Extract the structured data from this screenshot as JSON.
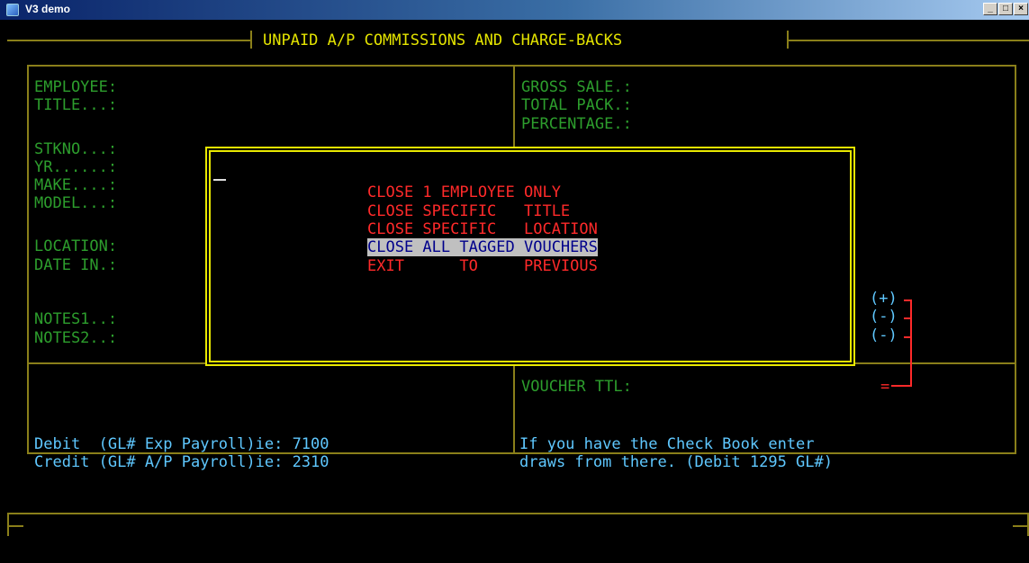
{
  "window": {
    "title": "V3 demo",
    "minimize_icon": "minimize-icon",
    "maximize_icon": "maximize-icon",
    "close_icon": "close-icon"
  },
  "header": {
    "title": "UNPAID A/P COMMISSIONS AND CHARGE-BACKS"
  },
  "fields_left": {
    "employee": "EMPLOYEE:",
    "title": "TITLE...:",
    "stkno": "STKNO...:",
    "yr": "YR......:",
    "make": "MAKE....:",
    "model": "MODEL...:",
    "location": "LOCATION:",
    "date_in": "DATE IN.:",
    "notes1": "NOTES1..:",
    "notes2": "NOTES2..:"
  },
  "fields_right": {
    "gross_sale": "GROSS SALE.:",
    "total_pack": "TOTAL PACK.:",
    "percentage": "PERCENTAGE.:",
    "voucher_ttl": "VOUCHER TTL:"
  },
  "calc_symbols": {
    "plus": "(+)",
    "minus1": "(-)",
    "minus2": "(-)",
    "equals": "="
  },
  "menu": {
    "items": [
      {
        "label": "CLOSE 1 EMPLOYEE ONLY"
      },
      {
        "label": "CLOSE SPECIFIC   TITLE"
      },
      {
        "label": "CLOSE SPECIFIC   LOCATION"
      },
      {
        "label": "CLOSE ALL TAGGED VOUCHERS"
      },
      {
        "label": "EXIT      TO     PREVIOUS"
      }
    ],
    "selected_index": 3
  },
  "footer": {
    "debit_label": "Debit  (GL# Exp Payroll)ie: 7100",
    "credit_label": "Credit (GL# A/P Payroll)ie: 2310",
    "hint_line1": "If you have the Check Book enter",
    "hint_line2": "draws from there. (Debit 1295 GL#)"
  },
  "colors": {
    "label_green": "#2d9e2d",
    "menu_red": "#ff2a2a",
    "popup_border": "#e8e800",
    "footer_cyan": "#5fc8ff",
    "outline": "#8a7f1a",
    "highlight_bg": "#c0c0c0",
    "highlight_fg": "#00008b"
  }
}
